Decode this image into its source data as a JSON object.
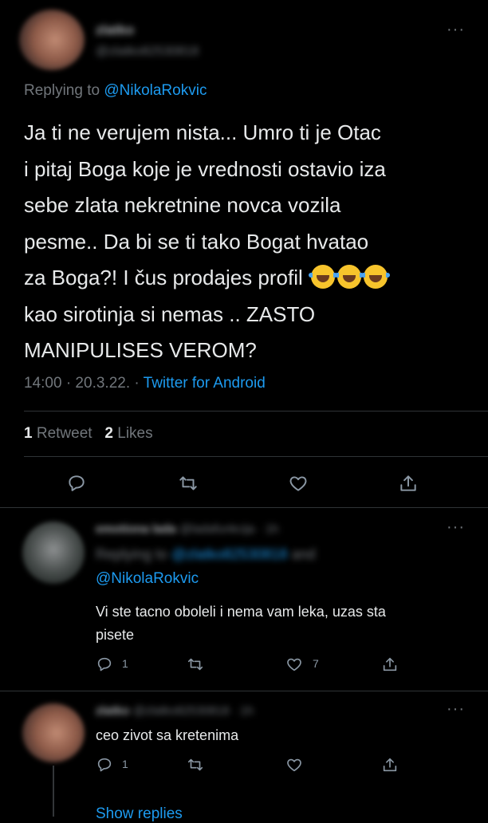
{
  "main_tweet": {
    "name": "zlatko",
    "handle": "@zlatko82530818",
    "more": "···",
    "replying_label": "Replying to",
    "replying_handle": "@NikolaRokvic",
    "text_lines": [
      "Ja ti ne verujem nista... Umro ti je Otac",
      "i pitaj Boga koje je vrednosti ostavio iza",
      "sebe zlata nekretnine novca vozila",
      "pesme.. Da bi se ti tako Bogat hvatao",
      "za Boga?! I čus prodajes profil",
      "kao sirotinja si nemas .. ZASTO",
      "MANIPULISES VEROM?"
    ],
    "emoji": [
      "face-with-tears-of-joy",
      "face-with-tears-of-joy",
      "face-with-tears-of-joy"
    ],
    "time": "14:00 · 20.3.22. ·",
    "source": "Twitter for Android",
    "retweets_count": "1",
    "retweets_label": "Retweet",
    "likes_count": "2",
    "likes_label": "Likes"
  },
  "replies": [
    {
      "name": "emotiona lada",
      "handle": "@ladafunkcija",
      "time": "· 1h",
      "more": "···",
      "replying_label": "Replying to",
      "replying_handle_1": "@zlatko82530818",
      "replying_and": "and",
      "replying_handle_2": "@NikolaRokvic",
      "text_lines": [
        "Vi ste tacno oboleli i nema vam leka, uzas sta",
        "pisete"
      ],
      "reply_count": "1",
      "retweet_count": "",
      "like_count": "7"
    },
    {
      "name": "zlatko",
      "handle": "@zlatko82530818",
      "time": "· 1h",
      "more": "···",
      "text_lines": [
        "ceo zivot sa kretenima"
      ],
      "reply_count": "1",
      "retweet_count": "",
      "like_count": ""
    }
  ],
  "show_replies": "Show replies",
  "colors": {
    "background": "#000000",
    "accent": "#1d9bf0",
    "text": "#e7e9ea",
    "muted": "#71767b"
  }
}
